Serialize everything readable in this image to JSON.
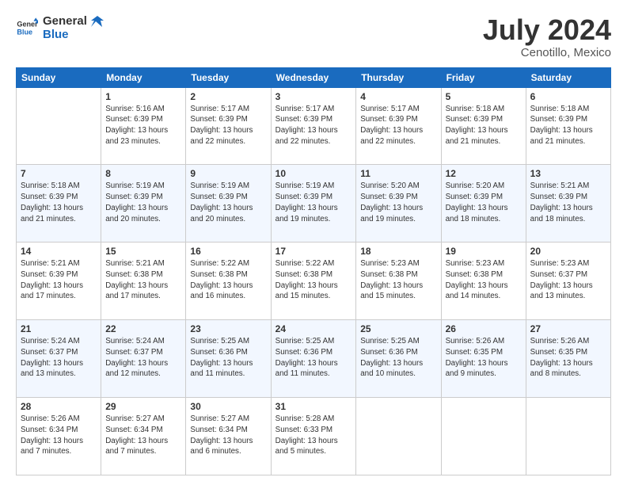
{
  "logo": {
    "line1": "General",
    "line2": "Blue"
  },
  "title": "July 2024",
  "subtitle": "Cenotillo, Mexico",
  "days_header": [
    "Sunday",
    "Monday",
    "Tuesday",
    "Wednesday",
    "Thursday",
    "Friday",
    "Saturday"
  ],
  "weeks": [
    [
      {
        "day": "",
        "sunrise": "",
        "sunset": "",
        "daylight": ""
      },
      {
        "day": "1",
        "sunrise": "Sunrise: 5:16 AM",
        "sunset": "Sunset: 6:39 PM",
        "daylight": "Daylight: 13 hours and 23 minutes."
      },
      {
        "day": "2",
        "sunrise": "Sunrise: 5:17 AM",
        "sunset": "Sunset: 6:39 PM",
        "daylight": "Daylight: 13 hours and 22 minutes."
      },
      {
        "day": "3",
        "sunrise": "Sunrise: 5:17 AM",
        "sunset": "Sunset: 6:39 PM",
        "daylight": "Daylight: 13 hours and 22 minutes."
      },
      {
        "day": "4",
        "sunrise": "Sunrise: 5:17 AM",
        "sunset": "Sunset: 6:39 PM",
        "daylight": "Daylight: 13 hours and 22 minutes."
      },
      {
        "day": "5",
        "sunrise": "Sunrise: 5:18 AM",
        "sunset": "Sunset: 6:39 PM",
        "daylight": "Daylight: 13 hours and 21 minutes."
      },
      {
        "day": "6",
        "sunrise": "Sunrise: 5:18 AM",
        "sunset": "Sunset: 6:39 PM",
        "daylight": "Daylight: 13 hours and 21 minutes."
      }
    ],
    [
      {
        "day": "7",
        "sunrise": "Sunrise: 5:18 AM",
        "sunset": "Sunset: 6:39 PM",
        "daylight": "Daylight: 13 hours and 21 minutes."
      },
      {
        "day": "8",
        "sunrise": "Sunrise: 5:19 AM",
        "sunset": "Sunset: 6:39 PM",
        "daylight": "Daylight: 13 hours and 20 minutes."
      },
      {
        "day": "9",
        "sunrise": "Sunrise: 5:19 AM",
        "sunset": "Sunset: 6:39 PM",
        "daylight": "Daylight: 13 hours and 20 minutes."
      },
      {
        "day": "10",
        "sunrise": "Sunrise: 5:19 AM",
        "sunset": "Sunset: 6:39 PM",
        "daylight": "Daylight: 13 hours and 19 minutes."
      },
      {
        "day": "11",
        "sunrise": "Sunrise: 5:20 AM",
        "sunset": "Sunset: 6:39 PM",
        "daylight": "Daylight: 13 hours and 19 minutes."
      },
      {
        "day": "12",
        "sunrise": "Sunrise: 5:20 AM",
        "sunset": "Sunset: 6:39 PM",
        "daylight": "Daylight: 13 hours and 18 minutes."
      },
      {
        "day": "13",
        "sunrise": "Sunrise: 5:21 AM",
        "sunset": "Sunset: 6:39 PM",
        "daylight": "Daylight: 13 hours and 18 minutes."
      }
    ],
    [
      {
        "day": "14",
        "sunrise": "Sunrise: 5:21 AM",
        "sunset": "Sunset: 6:39 PM",
        "daylight": "Daylight: 13 hours and 17 minutes."
      },
      {
        "day": "15",
        "sunrise": "Sunrise: 5:21 AM",
        "sunset": "Sunset: 6:38 PM",
        "daylight": "Daylight: 13 hours and 17 minutes."
      },
      {
        "day": "16",
        "sunrise": "Sunrise: 5:22 AM",
        "sunset": "Sunset: 6:38 PM",
        "daylight": "Daylight: 13 hours and 16 minutes."
      },
      {
        "day": "17",
        "sunrise": "Sunrise: 5:22 AM",
        "sunset": "Sunset: 6:38 PM",
        "daylight": "Daylight: 13 hours and 15 minutes."
      },
      {
        "day": "18",
        "sunrise": "Sunrise: 5:23 AM",
        "sunset": "Sunset: 6:38 PM",
        "daylight": "Daylight: 13 hours and 15 minutes."
      },
      {
        "day": "19",
        "sunrise": "Sunrise: 5:23 AM",
        "sunset": "Sunset: 6:38 PM",
        "daylight": "Daylight: 13 hours and 14 minutes."
      },
      {
        "day": "20",
        "sunrise": "Sunrise: 5:23 AM",
        "sunset": "Sunset: 6:37 PM",
        "daylight": "Daylight: 13 hours and 13 minutes."
      }
    ],
    [
      {
        "day": "21",
        "sunrise": "Sunrise: 5:24 AM",
        "sunset": "Sunset: 6:37 PM",
        "daylight": "Daylight: 13 hours and 13 minutes."
      },
      {
        "day": "22",
        "sunrise": "Sunrise: 5:24 AM",
        "sunset": "Sunset: 6:37 PM",
        "daylight": "Daylight: 13 hours and 12 minutes."
      },
      {
        "day": "23",
        "sunrise": "Sunrise: 5:25 AM",
        "sunset": "Sunset: 6:36 PM",
        "daylight": "Daylight: 13 hours and 11 minutes."
      },
      {
        "day": "24",
        "sunrise": "Sunrise: 5:25 AM",
        "sunset": "Sunset: 6:36 PM",
        "daylight": "Daylight: 13 hours and 11 minutes."
      },
      {
        "day": "25",
        "sunrise": "Sunrise: 5:25 AM",
        "sunset": "Sunset: 6:36 PM",
        "daylight": "Daylight: 13 hours and 10 minutes."
      },
      {
        "day": "26",
        "sunrise": "Sunrise: 5:26 AM",
        "sunset": "Sunset: 6:35 PM",
        "daylight": "Daylight: 13 hours and 9 minutes."
      },
      {
        "day": "27",
        "sunrise": "Sunrise: 5:26 AM",
        "sunset": "Sunset: 6:35 PM",
        "daylight": "Daylight: 13 hours and 8 minutes."
      }
    ],
    [
      {
        "day": "28",
        "sunrise": "Sunrise: 5:26 AM",
        "sunset": "Sunset: 6:34 PM",
        "daylight": "Daylight: 13 hours and 7 minutes."
      },
      {
        "day": "29",
        "sunrise": "Sunrise: 5:27 AM",
        "sunset": "Sunset: 6:34 PM",
        "daylight": "Daylight: 13 hours and 7 minutes."
      },
      {
        "day": "30",
        "sunrise": "Sunrise: 5:27 AM",
        "sunset": "Sunset: 6:34 PM",
        "daylight": "Daylight: 13 hours and 6 minutes."
      },
      {
        "day": "31",
        "sunrise": "Sunrise: 5:28 AM",
        "sunset": "Sunset: 6:33 PM",
        "daylight": "Daylight: 13 hours and 5 minutes."
      },
      {
        "day": "",
        "sunrise": "",
        "sunset": "",
        "daylight": ""
      },
      {
        "day": "",
        "sunrise": "",
        "sunset": "",
        "daylight": ""
      },
      {
        "day": "",
        "sunrise": "",
        "sunset": "",
        "daylight": ""
      }
    ]
  ]
}
